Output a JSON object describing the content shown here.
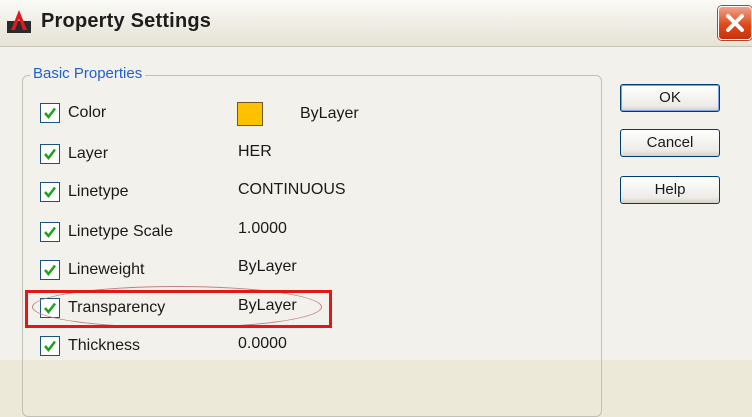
{
  "window": {
    "title": "Property Settings"
  },
  "group": {
    "label": "Basic Properties"
  },
  "properties": [
    {
      "label": "Color",
      "value": "ByLayer",
      "checked": true
    },
    {
      "label": "Layer",
      "value": "HER",
      "checked": true
    },
    {
      "label": "Linetype",
      "value": "CONTINUOUS",
      "checked": true
    },
    {
      "label": "Linetype Scale",
      "value": "1.0000",
      "checked": true
    },
    {
      "label": "Lineweight",
      "value": "ByLayer",
      "checked": true
    },
    {
      "label": "Transparency",
      "value": "ByLayer",
      "checked": true
    },
    {
      "label": "Thickness",
      "value": "0.0000",
      "checked": true
    }
  ],
  "color_swatch": "#ffc000",
  "buttons": {
    "ok": "OK",
    "cancel": "Cancel",
    "help": "Help"
  },
  "icons": {
    "app": "autocad-app-icon",
    "close": "close-icon",
    "check": "checkmark-icon"
  },
  "colors": {
    "highlight": "#e01818",
    "group_label": "#1f5fd1",
    "close_button": "#e04a1a"
  }
}
